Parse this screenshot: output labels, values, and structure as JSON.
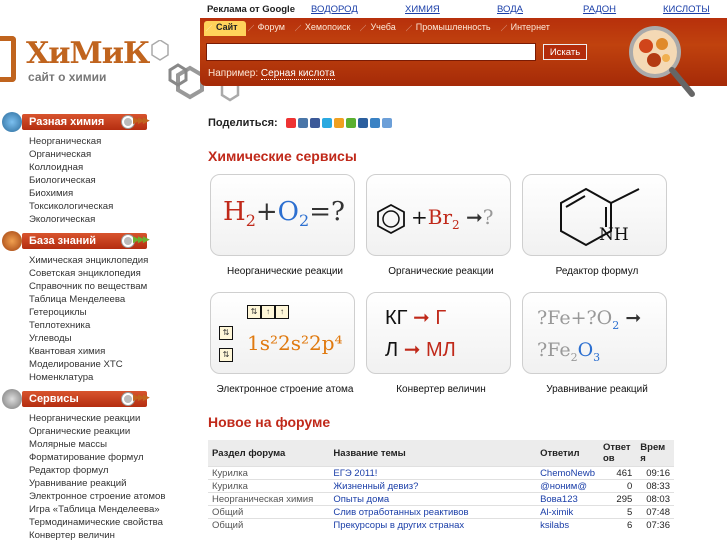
{
  "logo": {
    "word": "ХиМиК",
    "subtitle": "сайт о химии"
  },
  "top_ads": {
    "label": "Реклама от Google",
    "links": [
      "ВОДОРОД",
      "ХИМИЯ",
      "ВОДА",
      "РАДОН",
      "КИСЛОТЫ"
    ]
  },
  "search": {
    "tabs": [
      "Сайт",
      "Форум",
      "Хемопоиск",
      "Учеба",
      "Промышленность",
      "Интернет"
    ],
    "input_value": "",
    "button_label": "Искать",
    "example_label": "Например:",
    "example_link": "Серная кислота"
  },
  "share": {
    "label": "Поделиться:"
  },
  "sidebar": {
    "sections": [
      {
        "title": "Разная химия",
        "items": [
          "Неорганическая",
          "Органическая",
          "Коллоидная",
          "Биологическая",
          "Биохимия",
          "Токсикологическая",
          "Экологическая"
        ]
      },
      {
        "title": "База знаний",
        "items": [
          "Химическая энциклопедия",
          "Советская энциклопедия",
          "Справочник по веществам",
          "Таблица Менделеева",
          "Гетероциклы",
          "Теплотехника",
          "Углеводы",
          "Квантовая химия",
          "Моделирование ХТС",
          "Номенклатура"
        ]
      },
      {
        "title": "Сервисы",
        "items": [
          "Неорганические реакции",
          "Органические реакции",
          "Молярные массы",
          "Форматирование формул",
          "Редактор формул",
          "Уравнивание реакций",
          "Электронное строение атомов",
          "Игра «Таблица Менделеева»",
          "Термодинамические свойства",
          "Конвертер величин"
        ]
      }
    ]
  },
  "services": {
    "title": "Химические сервисы",
    "items": [
      {
        "label": "Неорганические реакции",
        "f1": "H",
        "f1s": "2",
        "f2": "O",
        "f2s": "2",
        "q": "?"
      },
      {
        "label": "Органические реакции",
        "reagent": "Br",
        "reagent_sub": "2",
        "q": "?"
      },
      {
        "label": "Редактор формул",
        "group": "NH"
      },
      {
        "label": "Электронное строение атома",
        "config": "1s²2s²2p⁴"
      },
      {
        "label": "Конвертер величин",
        "row1_from": "КГ",
        "row1_to": "Г",
        "row2_from": "Л",
        "row2_to": "МЛ"
      },
      {
        "label": "Уравнивание реакций",
        "line1": "?Fe+?O",
        "line1_sub": "2",
        "line2a": "?Fe",
        "line2_sub1": "2",
        "line2b": "O",
        "line2_sub2": "3"
      }
    ]
  },
  "forum": {
    "title": "Новое на форуме",
    "headers": [
      "Раздел форума",
      "Название темы",
      "Ответил",
      "Ответов",
      "Время"
    ],
    "rows": [
      [
        "Курилка",
        "ЕГЭ 2011!",
        "ChemoNewb",
        "461",
        "09:16"
      ],
      [
        "Курилка",
        "Жизненный девиз?",
        "@нoним@",
        "0",
        "08:33"
      ],
      [
        "Неорганическая химия",
        "Опыты дома",
        "Вова123",
        "295",
        "08:03"
      ],
      [
        "Общий",
        "Слив отработанных реактивов",
        "Al-ximik",
        "5",
        "07:48"
      ],
      [
        "Общий",
        "Прекурсоры в других странах",
        "ksilabs",
        "6",
        "07:36"
      ]
    ]
  },
  "colors": {
    "brand": "#c0641e",
    "band": "#b7300c",
    "title_red": "#c0291a",
    "link": "#1a3ea8",
    "formula_blue": "#2c6fd0",
    "formula_orange": "#e07a10"
  }
}
